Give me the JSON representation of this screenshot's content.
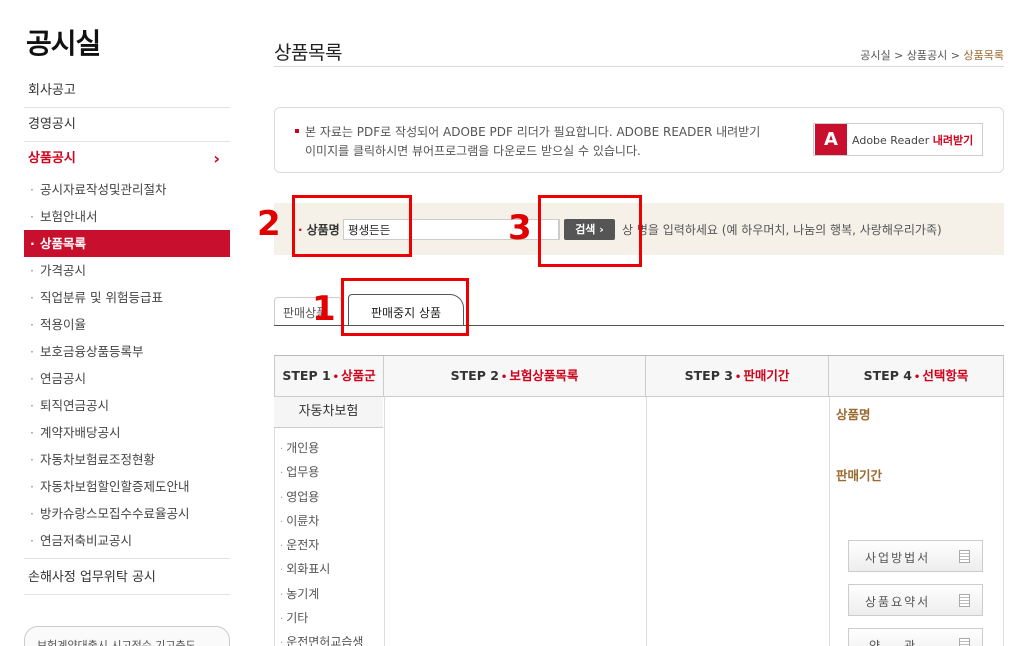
{
  "sidebar": {
    "title": "공시실",
    "top_items": [
      {
        "label": "회사공고"
      },
      {
        "label": "경영공시"
      },
      {
        "label": "상품공시"
      }
    ],
    "sub_items": [
      {
        "label": "공시자료작성및관리절차"
      },
      {
        "label": "보험안내서"
      },
      {
        "label": "상품목록"
      },
      {
        "label": "가격공시"
      },
      {
        "label": "직업분류 및 위험등급표"
      },
      {
        "label": "적용이율"
      },
      {
        "label": "보호금융상품등록부"
      },
      {
        "label": "연금공시"
      },
      {
        "label": "퇴직연금공시"
      },
      {
        "label": "계약자배당공시"
      },
      {
        "label": "자동차보험료조정현황"
      },
      {
        "label": "자동차보험할인할증제도안내"
      },
      {
        "label": "방카슈랑스모집수수료율공시"
      },
      {
        "label": "연금저축비교공시"
      }
    ],
    "bottom_item": "손해사정 업무위탁 공시",
    "banner": "보험계약대출시 시고전수 기고층도"
  },
  "main": {
    "page_title": "상품목록",
    "breadcrumb": [
      "공시실",
      ">",
      "상품공시",
      ">",
      "상품목록"
    ],
    "notice_line1": "본 자료는 PDF로 작성되어 ADOBE PDF 리더가 필요합니다. ADOBE READER 내려받기",
    "notice_line2": "이미지를 클릭하시면 뷰어프로그램을 다운로드 받으실 수 있습니다.",
    "adobe_logo": "A",
    "adobe_label": "Adobe Reader",
    "adobe_download": "내려받기"
  },
  "search": {
    "label": "상품명",
    "value": "평생든든",
    "button": "검색 ›",
    "hint": "상  명을 입력하세요 (예 하우머치, 나눔의 행복, 사랑해우리가족)"
  },
  "tabs": [
    {
      "label": "판매상품"
    },
    {
      "label": "판매중지 상품"
    }
  ],
  "steps": {
    "headers": [
      {
        "step": "STEP 1",
        "title": "상품군"
      },
      {
        "step": "STEP 2",
        "title": "보험상품목록"
      },
      {
        "step": "STEP 3",
        "title": "판매기간"
      },
      {
        "step": "STEP 4",
        "title": "선택항목"
      }
    ],
    "category_head": "자동차보험",
    "categories": [
      "개인용",
      "업무용",
      "영업용",
      "이륜차",
      "운전자",
      "외화표시",
      "농기계",
      "기타",
      "운전면허교습생"
    ],
    "step4_labels": [
      "상품명",
      "판매기간"
    ],
    "doc_buttons": [
      "사업방법서",
      "상품요약서",
      "약관"
    ]
  },
  "annotations": [
    {
      "number": "1"
    },
    {
      "number": "2"
    },
    {
      "number": "3"
    }
  ],
  "colors": {
    "accent_red": "#c8102e",
    "brown_label": "#9a6a2e",
    "search_bg": "#f5f1e8",
    "annotation_red": "#ee0000"
  }
}
